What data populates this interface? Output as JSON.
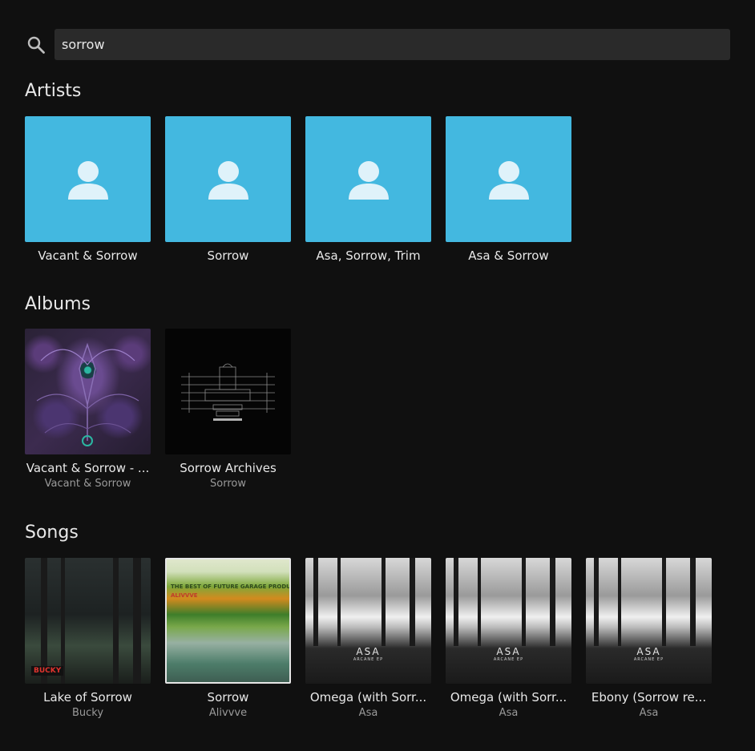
{
  "search": {
    "query": "sorrow",
    "placeholder": ""
  },
  "sections": {
    "artists_title": "Artists",
    "albums_title": "Albums",
    "songs_title": "Songs"
  },
  "artists": [
    {
      "name": "Vacant & Sorrow"
    },
    {
      "name": "Sorrow"
    },
    {
      "name": "Asa, Sorrow, Trim"
    },
    {
      "name": "Asa & Sorrow"
    }
  ],
  "albums": [
    {
      "title": "Vacant & Sorrow - ...",
      "artist": "Vacant & Sorrow"
    },
    {
      "title": "Sorrow Archives",
      "artist": "Sorrow"
    }
  ],
  "songs": [
    {
      "title": "Lake of Sorrow",
      "artist": "Bucky",
      "badge": "BUCKY"
    },
    {
      "title": "Sorrow",
      "artist": "Alivvve",
      "cover_heading": "THE BEST OF FUTURE GARAGE PRODUCER:",
      "cover_name": "ALIVVVE"
    },
    {
      "title": "Omega (with Sorr...",
      "artist": "Asa",
      "cover_logo": "ASA",
      "cover_sub": "ARCANE EP"
    },
    {
      "title": "Omega (with Sorr...",
      "artist": "Asa",
      "cover_logo": "ASA",
      "cover_sub": "ARCANE EP"
    },
    {
      "title": "Ebony (Sorrow re...",
      "artist": "Asa",
      "cover_logo": "ASA",
      "cover_sub": "ARCANE EP"
    }
  ],
  "colors": {
    "background": "#101010",
    "artist_placeholder": "#43b8e0",
    "search_field": "#2a2a2a"
  },
  "icons": {
    "search": "search-icon",
    "artist_placeholder": "person-icon"
  }
}
